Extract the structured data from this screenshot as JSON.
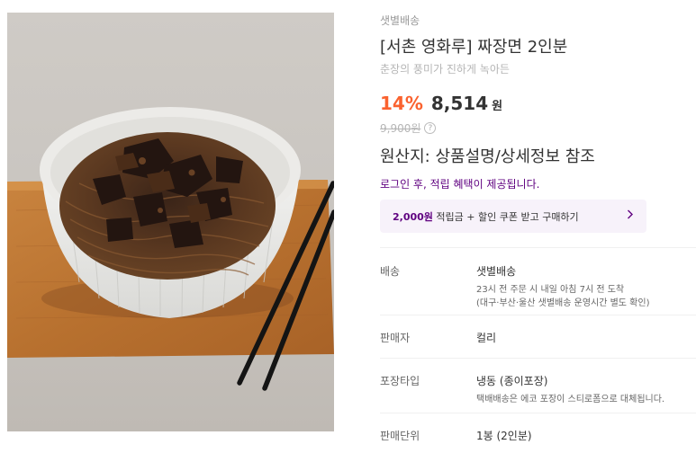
{
  "product": {
    "delivery_tag": "샛별배송",
    "title": "[서촌 영화루] 짜장면 2인분",
    "subtitle": "춘장의 풍미가 진하게 녹아든",
    "discount": "14%",
    "price": "8,514",
    "currency": "원",
    "original_price": "9,900원",
    "origin": "원산지: 상품설명/상세정보 참조",
    "login_benefit": "로그인 후, 적립 혜택이 제공됩니다.",
    "coupon": {
      "amount": "2,000원",
      "text": " 적립금 + 할인 쿠폰 받고 구매하기"
    }
  },
  "details": {
    "shipping": {
      "label": "배송",
      "value": "샛별배송",
      "sub1": "23시 전 주문 시 내일 아침 7시 전 도착",
      "sub2": "(대구·부산·울산 샛별배송 운영시간 별도 확인)"
    },
    "seller": {
      "label": "판매자",
      "value": "컬리"
    },
    "packaging": {
      "label": "포장타입",
      "value": "냉동 (종이포장)",
      "sub1": "택배배송은 에코 포장이 스티로폼으로 대체됩니다."
    },
    "unit": {
      "label": "판매단위",
      "value": "1봉 (2인분)"
    }
  },
  "colors": {
    "accent": "#5f0080",
    "discount": "#fa622f",
    "coupon_bg": "#f7f2fa"
  }
}
